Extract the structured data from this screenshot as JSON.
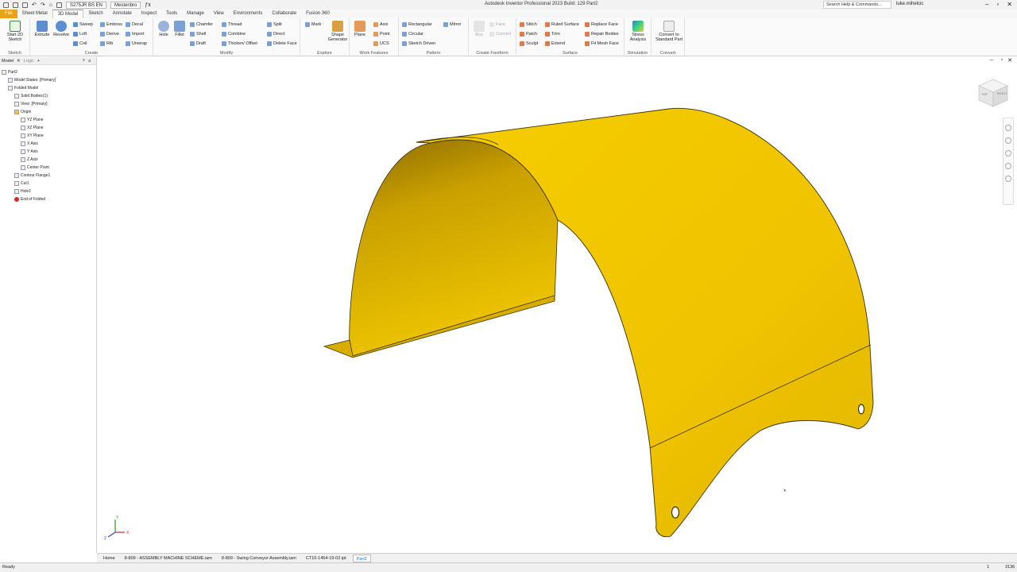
{
  "titlebar": {
    "project": "S275JR BS EN",
    "material": "Mestenbro",
    "title": "Autodesk Inventor Professional 2023 Build: 129   Part2",
    "search_placeholder": "Search Help & Commands...",
    "user": "luke.mihelcic"
  },
  "tabs": [
    "File",
    "Sheet Metal",
    "3D Model",
    "Sketch",
    "Annotate",
    "Inspect",
    "Tools",
    "Manage",
    "View",
    "Environments",
    "Collaborate",
    "Fusion 360"
  ],
  "active_tab": "3D Model",
  "ribbon": {
    "sketch": {
      "title": "Sketch",
      "start": "Start 2D Sketch"
    },
    "create": {
      "title": "Create",
      "extrude": "Extrude",
      "revolve": "Revolve",
      "sweep": "Sweep",
      "loft": "Loft",
      "coil": "Coil",
      "emboss": "Emboss",
      "derive": "Derive",
      "rib": "Rib",
      "decal": "Decal",
      "import": "Import",
      "unwrap": "Unwrap"
    },
    "modify": {
      "title": "Modify",
      "hole": "Hole",
      "fillet": "Fillet",
      "chamfer": "Chamfer",
      "shell": "Shell",
      "draft": "Draft",
      "thread": "Thread",
      "combine": "Combine",
      "thicken": "Thicken/ Offset",
      "split": "Split",
      "direct": "Direct",
      "delete_face": "Delete Face"
    },
    "explore": {
      "title": "Explore",
      "mark": "Mark",
      "shape": "Shape Generator"
    },
    "work": {
      "title": "Work Features",
      "plane": "Plane",
      "axis": "Axis",
      "point": "Point",
      "ucs": "UCS"
    },
    "pattern": {
      "title": "Pattern",
      "rect": "Rectangular",
      "circular": "Circular",
      "sketch_driven": "Sketch Driven",
      "mirror": "Mirror"
    },
    "freeform": {
      "title": "Create Freeform",
      "box": "Box",
      "face": "Face",
      "convert": "Convert"
    },
    "surface": {
      "title": "Surface",
      "stitch": "Stitch",
      "patch": "Patch",
      "sculpt": "Sculpt",
      "ruled": "Ruled Surface",
      "trim": "Trim",
      "extend": "Extend",
      "replace": "Replace Face",
      "repair": "Repair Bodies",
      "fit": "Fit Mesh Face"
    },
    "simulation": {
      "title": "Simulation",
      "stress": "Stress Analysis"
    },
    "convert": {
      "title": "Convert",
      "std": "Convert to Standard Part"
    }
  },
  "browser": {
    "tabs": [
      "Model",
      "Logic"
    ],
    "nodes": [
      "Part2",
      "Model States: [Primary]",
      "Folded Model",
      "Solid Bodies(1)",
      "View: [Primary]",
      "Origin",
      "YZ Plane",
      "XZ Plane",
      "XY Plane",
      "X Axis",
      "Y Axis",
      "Z Axis",
      "Center Point",
      "Contour Flange1",
      "Cut1",
      "Hole1",
      "End of Folded"
    ]
  },
  "doc_tabs": [
    "Home",
    "8-809 - ASSEMBLY MACHINE SCHEME.iam",
    "8-809 - Swing Conveyor Assembly.iam",
    "CT10-1454-19-02.ipt",
    "Part2"
  ],
  "status": {
    "left": "Ready",
    "page": "1",
    "count": "3136"
  },
  "viewcube": {
    "top": "TOP",
    "right": "RIGHT"
  },
  "triad": {
    "x": "X",
    "y": "Y",
    "z": "Z"
  },
  "colors": {
    "part": "#f0c300",
    "part_dark": "#8a6a00",
    "accent": "#e8a317",
    "active_doc": "#1a73c8"
  }
}
